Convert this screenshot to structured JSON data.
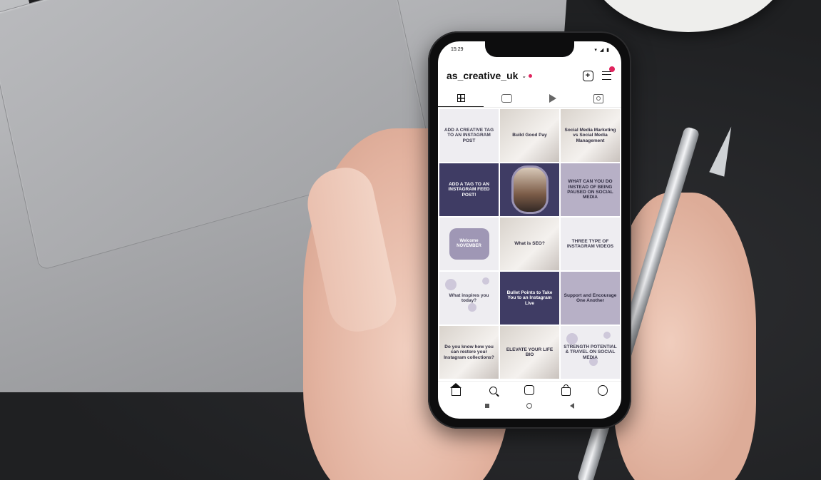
{
  "status_bar": {
    "time": "15:29",
    "icons": "▾ ◢ ▮"
  },
  "profile": {
    "username": "as_creative_uk",
    "chevron": "⌄"
  },
  "tiles": [
    {
      "text": "ADD A CREATIVE TAG TO AN INSTAGRAM POST",
      "style": "t-light"
    },
    {
      "text": "Build Good Pay",
      "style": "t-photo"
    },
    {
      "text": "Social Media Marketing vs Social Media Management",
      "style": "t-photo"
    },
    {
      "text": "ADD A TAG TO AN INSTAGRAM FEED POST!",
      "style": "t-dark"
    },
    {
      "text": "",
      "style": "t-dark"
    },
    {
      "text": "WHAT CAN YOU DO INSTEAD OF BEING PAUSED ON SOCIAL MEDIA",
      "style": "t-mid"
    },
    {
      "text": "Welcome NOVEMBER",
      "style": "t-light"
    },
    {
      "text": "What is SEO?",
      "style": "t-photo"
    },
    {
      "text": "THREE TYPE OF INSTAGRAM VIDEOS",
      "style": "t-light"
    },
    {
      "text": "What inspires you today?",
      "style": "t-light"
    },
    {
      "text": "Bullet Points to Take You to an Instagram Live",
      "style": "t-dark"
    },
    {
      "text": "Support and Encourage One Another",
      "style": "t-mid"
    },
    {
      "text": "Do you know how you can restore your Instagram collections?",
      "style": "t-photo"
    },
    {
      "text": "ELEVATE YOUR LIFE BIO",
      "style": "t-photo"
    },
    {
      "text": "STRENGTH POTENTIAL & TRAVEL ON SOCIAL MEDIA",
      "style": "t-light"
    }
  ],
  "colors": {
    "accent": "#e0245e",
    "tile_dark": "#3f3c64",
    "tile_mid": "#b7b0c6"
  }
}
